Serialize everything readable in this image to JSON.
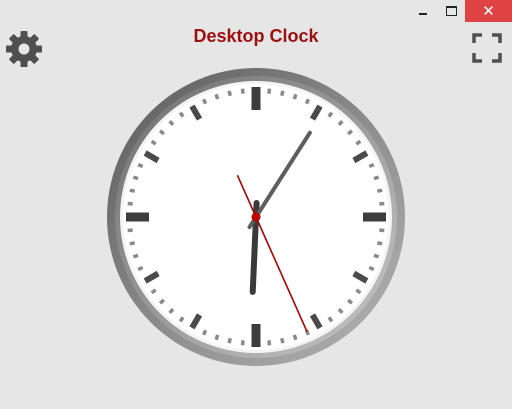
{
  "app": {
    "title": "Desktop Clock"
  },
  "window_controls": {
    "minimize_icon": "minimize-icon",
    "maximize_icon": "maximize-icon",
    "close_label": "✕"
  },
  "toolbar": {
    "settings_icon": "gear-icon",
    "fullscreen_icon": "fullscreen-icon"
  },
  "clock": {
    "hours": 6,
    "minutes": 5,
    "seconds": 26
  },
  "colors": {
    "title": "#9c1010",
    "second_hand": "#b00000",
    "close_button": "#e04343",
    "background": "#e6e6e6"
  }
}
